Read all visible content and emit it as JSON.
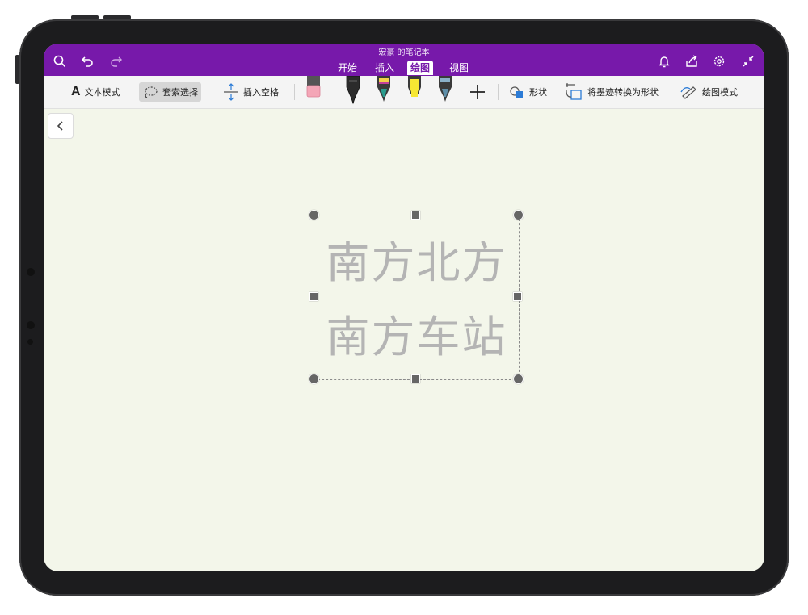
{
  "notebook_title": "宏豪 的笔记本",
  "tabs": [
    {
      "label": "开始",
      "active": false
    },
    {
      "label": "插入",
      "active": false
    },
    {
      "label": "绘图",
      "active": true
    },
    {
      "label": "视图",
      "active": false
    }
  ],
  "titlebar_icons": {
    "left": [
      "search-icon",
      "undo-icon",
      "redo-icon"
    ],
    "right": [
      "bell-icon",
      "share-icon",
      "settings-icon",
      "collapse-icon"
    ]
  },
  "ribbon": {
    "text_mode": "文本模式",
    "lasso_select": "套索选择",
    "insert_space": "插入空格",
    "shapes": "形状",
    "ink_to_shape": "将墨迹转换为形状",
    "draw_mode": "绘图模式",
    "pens": [
      {
        "name": "black-pen",
        "color": "#222222"
      },
      {
        "name": "teal-pen",
        "color": "#2a9d8f"
      },
      {
        "name": "yellow-highlighter",
        "color": "#f7e733"
      },
      {
        "name": "gray-pen",
        "color": "#8ab0c8"
      }
    ]
  },
  "canvas": {
    "ink_line1": "南方北方",
    "ink_line2": "南方车站",
    "ink_color": "#b4b4b4",
    "background": "#f3f6ea"
  },
  "colors": {
    "accent": "#7719aa"
  }
}
